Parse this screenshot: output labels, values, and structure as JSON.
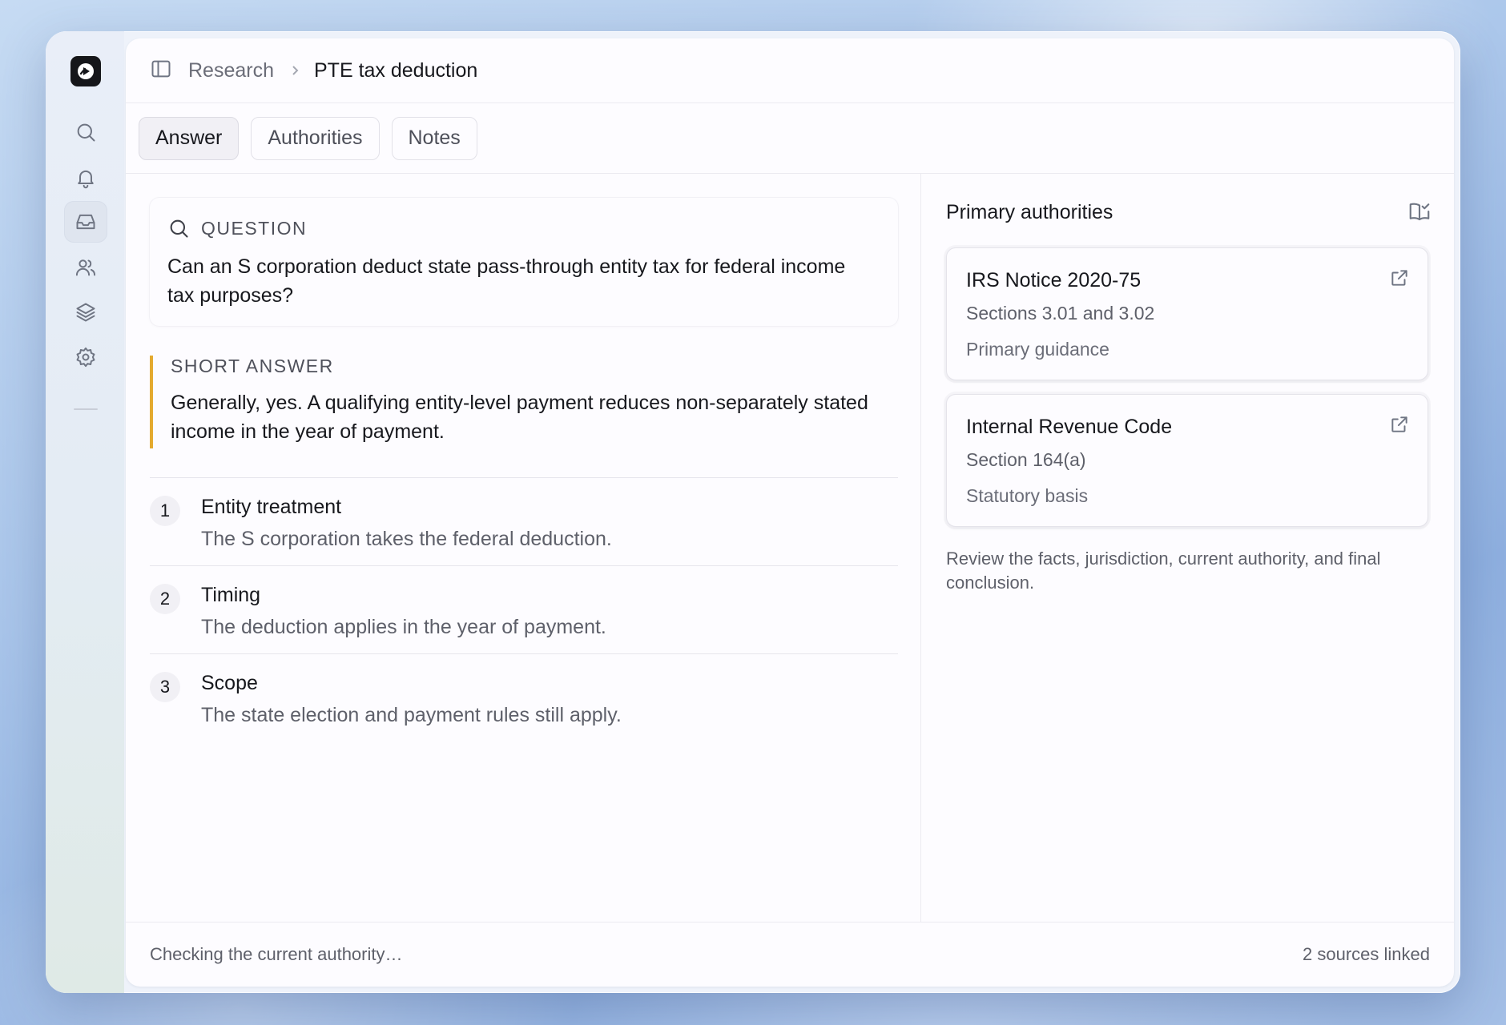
{
  "breadcrumb": {
    "parent": "Research",
    "current": "PTE tax deduction"
  },
  "tabs": [
    {
      "label": "Answer",
      "active": true
    },
    {
      "label": "Authorities",
      "active": false
    },
    {
      "label": "Notes",
      "active": false
    }
  ],
  "question": {
    "label": "QUESTION",
    "text": "Can an S corporation deduct state pass-through entity tax for federal income tax purposes?"
  },
  "short_answer": {
    "label": "SHORT ANSWER",
    "text": "Generally, yes. A qualifying entity-level payment reduces non-separately stated income in the year of payment."
  },
  "points": [
    {
      "number": "1",
      "title": "Entity treatment",
      "description": "The S corporation takes the federal deduction."
    },
    {
      "number": "2",
      "title": "Timing",
      "description": "The deduction applies in the year of payment."
    },
    {
      "number": "3",
      "title": "Scope",
      "description": "The state election and payment rules still apply."
    }
  ],
  "authorities": {
    "title": "Primary authorities",
    "items": [
      {
        "title": "IRS Notice 2020-75",
        "subtitle": "Sections 3.01 and 3.02",
        "meta": "Primary guidance"
      },
      {
        "title": "Internal Revenue Code",
        "subtitle": "Section 164(a)",
        "meta": "Statutory basis"
      }
    ],
    "review_note": "Review the facts, jurisdiction, current authority, and final conclusion."
  },
  "status": {
    "left": "Checking the current authority…",
    "right": "2 sources linked"
  },
  "colors": {
    "accent": "#e4aa2f",
    "logo": "#15161a"
  },
  "rail_icons": [
    "search-icon",
    "bell-icon",
    "inbox-icon",
    "users-icon",
    "layers-icon",
    "settings-icon"
  ]
}
